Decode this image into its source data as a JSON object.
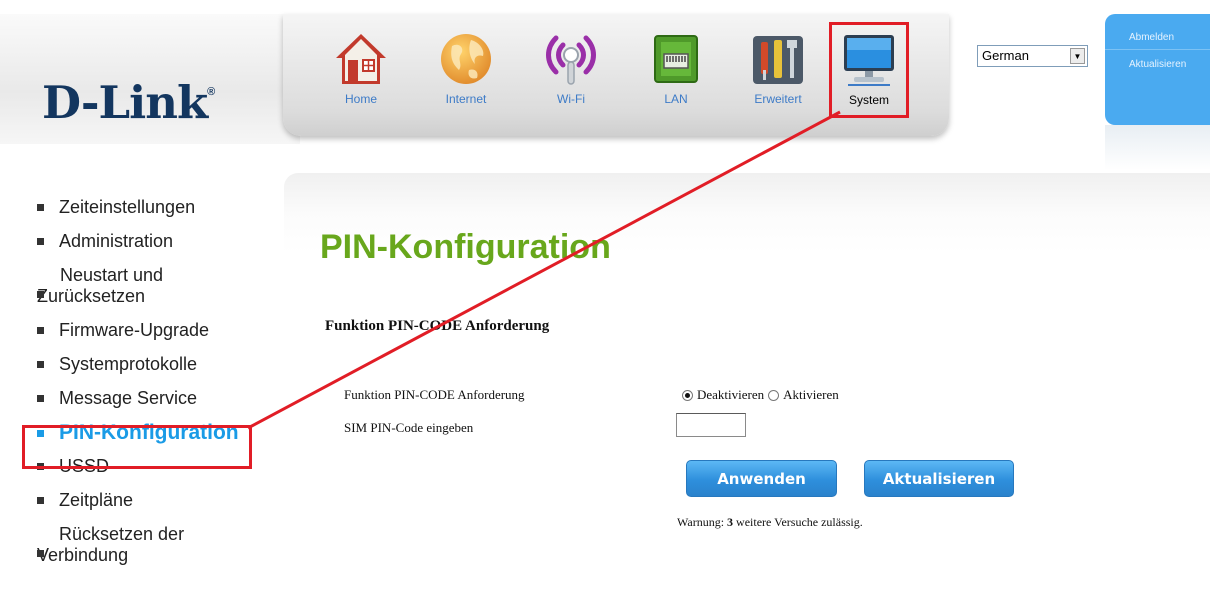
{
  "brand": {
    "name": "D-Link",
    "mark": "®"
  },
  "nav": {
    "items": [
      {
        "label": "Home",
        "icon": "home-icon"
      },
      {
        "label": "Internet",
        "icon": "globe-icon"
      },
      {
        "label": "Wi-Fi",
        "icon": "wifi-icon"
      },
      {
        "label": "LAN",
        "icon": "lan-port-icon"
      },
      {
        "label": "Erweitert",
        "icon": "tools-icon"
      },
      {
        "label": "System",
        "icon": "monitor-icon",
        "active": true
      }
    ]
  },
  "language": {
    "selected": "German"
  },
  "account": {
    "logout": "Abmelden",
    "refresh": "Aktualisieren"
  },
  "sidebar": {
    "items": [
      {
        "label": "Zeiteinstellungen"
      },
      {
        "label": "Administration"
      },
      {
        "label_1": "Neustart und",
        "label_2": "Zurücksetzen"
      },
      {
        "label": "Firmware-Upgrade"
      },
      {
        "label": "Systemprotokolle"
      },
      {
        "label": "Message Service"
      },
      {
        "label": "PIN-Konfiguration",
        "active": true
      },
      {
        "label": "USSD"
      },
      {
        "label": "Zeitpläne"
      },
      {
        "label_1": "Rücksetzen der",
        "label_2": "Verbindung"
      }
    ]
  },
  "main": {
    "title": "PIN-Konfiguration",
    "section_title": "Funktion PIN-CODE Anforderung",
    "pin_request_label": "Funktion PIN-CODE Anforderung",
    "pin_request_options": [
      {
        "label": "Deaktivieren",
        "checked": true
      },
      {
        "label": "Aktivieren",
        "checked": false
      }
    ],
    "sim_pin_label": "SIM PIN-Code eingeben",
    "sim_pin_value": "",
    "apply_label": "Anwenden",
    "refresh_label": "Aktualisieren",
    "warning_prefix": "Warnung:",
    "warning_count": "3",
    "warning_suffix": "weitere Versuche zulässig."
  },
  "colors": {
    "brand_navy": "#13365f",
    "link_blue": "#3d7bc7",
    "title_green": "#68a71c",
    "active_blue": "#1a9be6",
    "annotation_red": "#e11d26",
    "panel_blue": "#4aaaf0"
  }
}
